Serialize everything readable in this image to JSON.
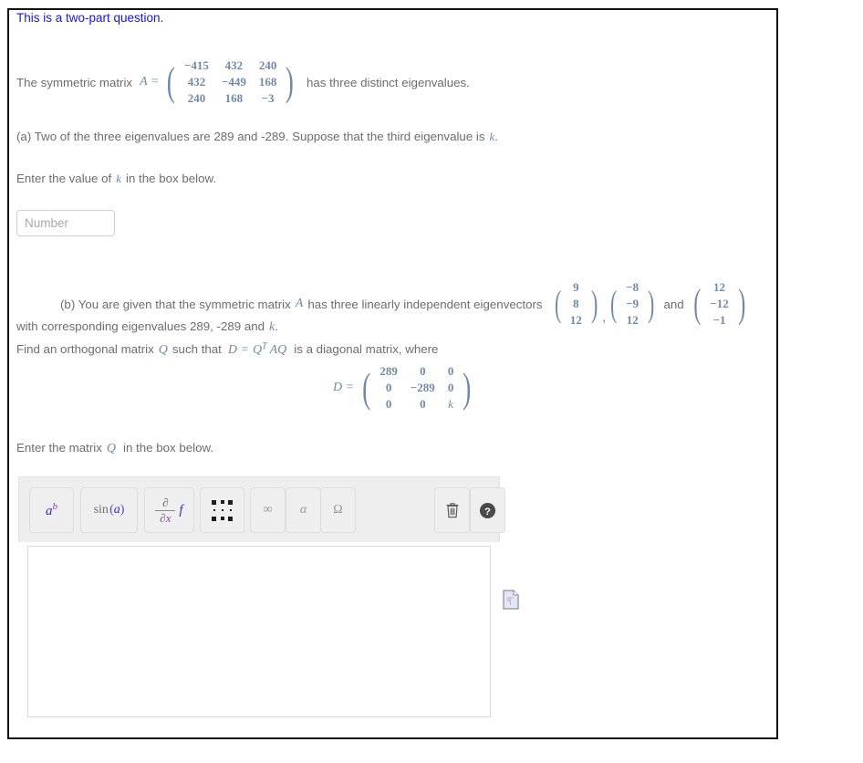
{
  "question": {
    "title": "This is a two-part question.",
    "intro_before": "The symmetric matrix",
    "intro_var": "A =",
    "intro_after": "has three distinct eigenvalues.",
    "matrix_A": [
      [
        "−415",
        "432",
        "240"
      ],
      [
        "432",
        "−449",
        "168"
      ],
      [
        "240",
        "168",
        "−3"
      ]
    ],
    "part_a": {
      "prompt": "(a) Two of the three eigenvalues are 289 and -289. Suppose that the third eigenvalue is",
      "prompt_var": "k",
      "prompt_end": ".",
      "instruction_before": "Enter the value of",
      "instruction_var": "k",
      "instruction_after": "in the box below.",
      "input_placeholder": "Number",
      "input_value": ""
    },
    "part_b": {
      "prompt_before": "(b) You are given that the symmetric matrix",
      "prompt_var": "A",
      "prompt_after": "has three linearly independent eigenvectors",
      "eigenvector_1": [
        "9",
        "8",
        "12"
      ],
      "eigenvector_2": [
        "−8",
        "−9",
        "12"
      ],
      "eigenvector_3": [
        "12",
        "−12",
        "−1"
      ],
      "vector_separator": ",",
      "vector_conjunction": "and",
      "eigenvalues_line_before": "with corresponding eigenvalues 289, -289 and",
      "eigenvalues_line_var": "k",
      "eigenvalues_line_end": ".",
      "find_before": "Find an orthogonal matrix",
      "find_var_q": "Q",
      "find_mid": "such that",
      "find_eq_d": "D =",
      "find_eq_qt": "Q",
      "find_eq_qt_sup": "T",
      "find_eq_aq": "AQ",
      "find_after": "is a diagonal matrix, where",
      "d_label": "D =",
      "matrix_D": [
        [
          "289",
          "0",
          "0"
        ],
        [
          "0",
          "−289",
          "0"
        ],
        [
          "0",
          "0",
          "k"
        ]
      ],
      "enter_before": "Enter the matrix",
      "enter_var": "Q",
      "enter_after": "in the box below."
    }
  },
  "math_editor": {
    "toolbar": {
      "buttons": [
        {
          "name": "exponent-button",
          "label": "a^b",
          "tooltip": "Exponent"
        },
        {
          "name": "function-button",
          "label": "sin (a)",
          "tooltip": "Functions"
        },
        {
          "name": "derivative-button",
          "label": "∂/∂x f",
          "tooltip": "Derivative"
        },
        {
          "name": "matrix-button",
          "label": "matrix",
          "tooltip": "Matrix"
        },
        {
          "name": "infinity-button",
          "label": "∞",
          "tooltip": "Infinity"
        },
        {
          "name": "greek-alpha-button",
          "label": "α",
          "tooltip": "Greek letters"
        },
        {
          "name": "greek-omega-button",
          "label": "Ω",
          "tooltip": "Greek capitals"
        }
      ],
      "trash_label": "Clear",
      "help_label": "Help"
    },
    "canvas_value": ""
  },
  "colors": {
    "title_blue": "#1414f0",
    "body_gray": "#6d6d6d",
    "math_blue_gray": "#7289a8",
    "toolbar_bg": "#eeeeee",
    "frame_black": "#111111",
    "file_icon_fill": "#e4e6f4",
    "file_icon_stroke": "#8f8fa6"
  }
}
